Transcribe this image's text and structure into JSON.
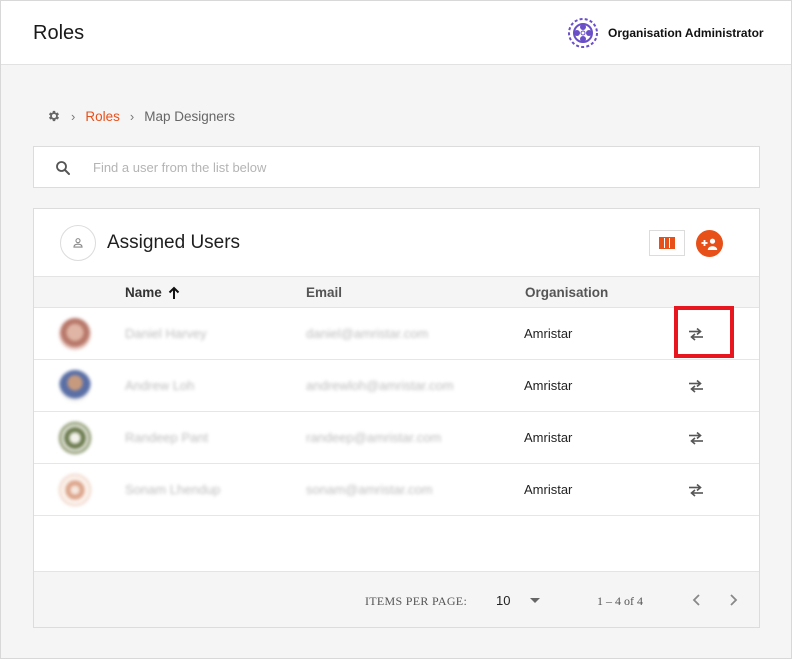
{
  "header": {
    "title": "Roles",
    "org_name": "Organisation Administrator",
    "logo_icon": "organisation-logo-icon"
  },
  "breadcrumb": {
    "root_icon": "gear-icon",
    "separator": "›",
    "link": "Roles",
    "current": "Map Designers"
  },
  "search": {
    "placeholder": "Find a user from the list below",
    "value": ""
  },
  "card": {
    "title": "Assigned Users",
    "columns_button_icon": "columns-icon",
    "add_user_button_icon": "add-user-icon"
  },
  "table": {
    "columns": [
      "Name",
      "Email",
      "Organisation"
    ],
    "sort_column": "Name",
    "sort_direction": "ascending",
    "rows": [
      {
        "name": "Daniel Harvey",
        "email": "daniel@amristar.com",
        "organisation": "Amristar"
      },
      {
        "name": "Andrew Loh",
        "email": "andrewloh@amristar.com",
        "organisation": "Amristar"
      },
      {
        "name": "Randeep Pant",
        "email": "randeep@amristar.com",
        "organisation": "Amristar"
      },
      {
        "name": "Sonam Lhendup",
        "email": "sonam@amristar.com",
        "organisation": "Amristar"
      }
    ],
    "row_action_icon": "swap-arrows-icon"
  },
  "pagination": {
    "items_per_page_label": "ITEMS PER PAGE:",
    "items_per_page": "10",
    "range": "1 – 4 of 4"
  },
  "colors": {
    "accent": "#e8501a",
    "highlight": "#e8161f",
    "logo": "#6a4fc9"
  }
}
